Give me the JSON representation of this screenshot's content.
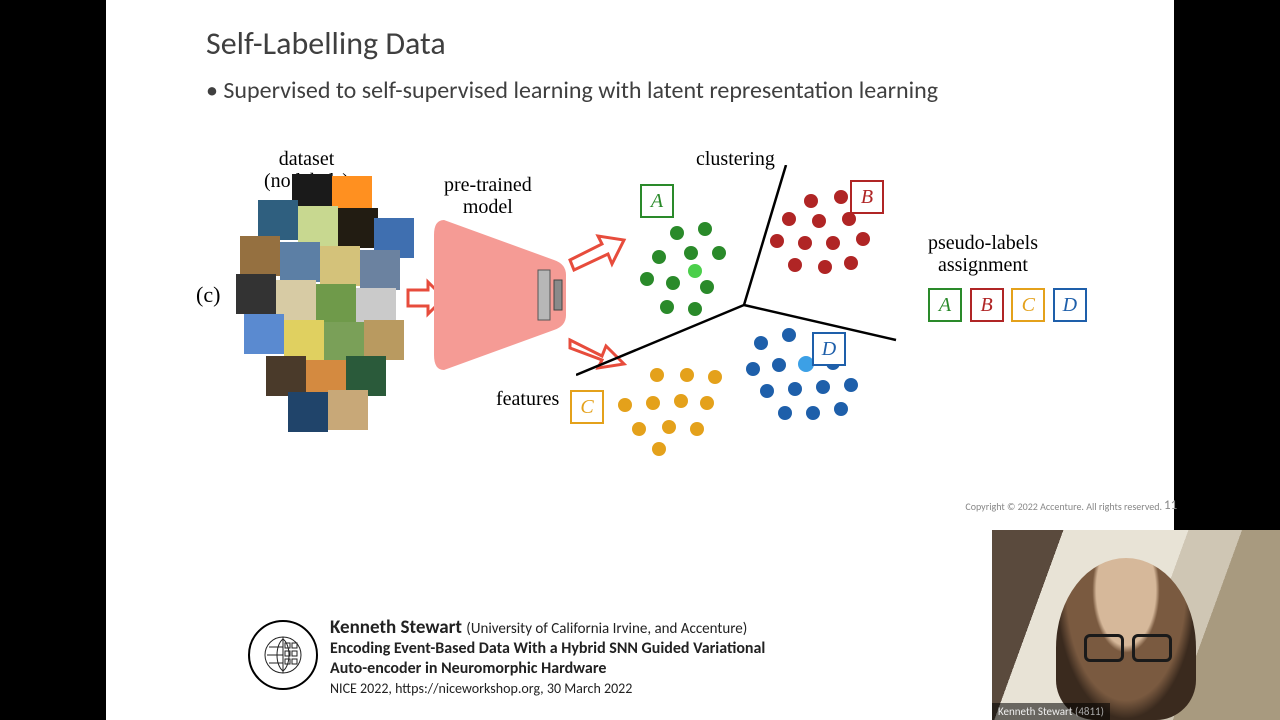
{
  "slide": {
    "title": "Self-Labelling Data",
    "bullet": "• Supervised to self-supervised learning with latent representation learning",
    "sublabel": "(c)",
    "copyright": "Copyright © 2022 Accenture. All rights reserved.",
    "page_number": "11"
  },
  "diagram": {
    "dataset_caption_line1": "dataset",
    "dataset_caption_line2": "(no labels)",
    "model_caption_line1": "pre-trained",
    "model_caption_line2": "model",
    "features_label": "features",
    "clustering_label": "clustering",
    "pseudo_line1": "pseudo-labels",
    "pseudo_line2": "assignment",
    "labels": {
      "A": "A",
      "B": "B",
      "C": "C",
      "D": "D"
    },
    "colors": {
      "A": "#2a8a2a",
      "B": "#b02525",
      "C": "#e4a11b",
      "D": "#1e5faa",
      "model_fill": "#f59b95",
      "model_inner": "#b7b7b7",
      "arrow": "#e74c3c"
    }
  },
  "footer": {
    "speaker": "Kenneth Stewart",
    "affiliation": "(University of California Irvine, and Accenture)",
    "title_line1": "Encoding Event-Based Data With a Hybrid SNN Guided Variational",
    "title_line2": "Auto-encoder in Neuromorphic Hardware",
    "event": "NICE 2022, https://niceworkshop.org, 30 March 2022",
    "logo_badge": "NICE 2022"
  },
  "webcam": {
    "name": "Kenneth Stewart",
    "id": "(4811)"
  }
}
